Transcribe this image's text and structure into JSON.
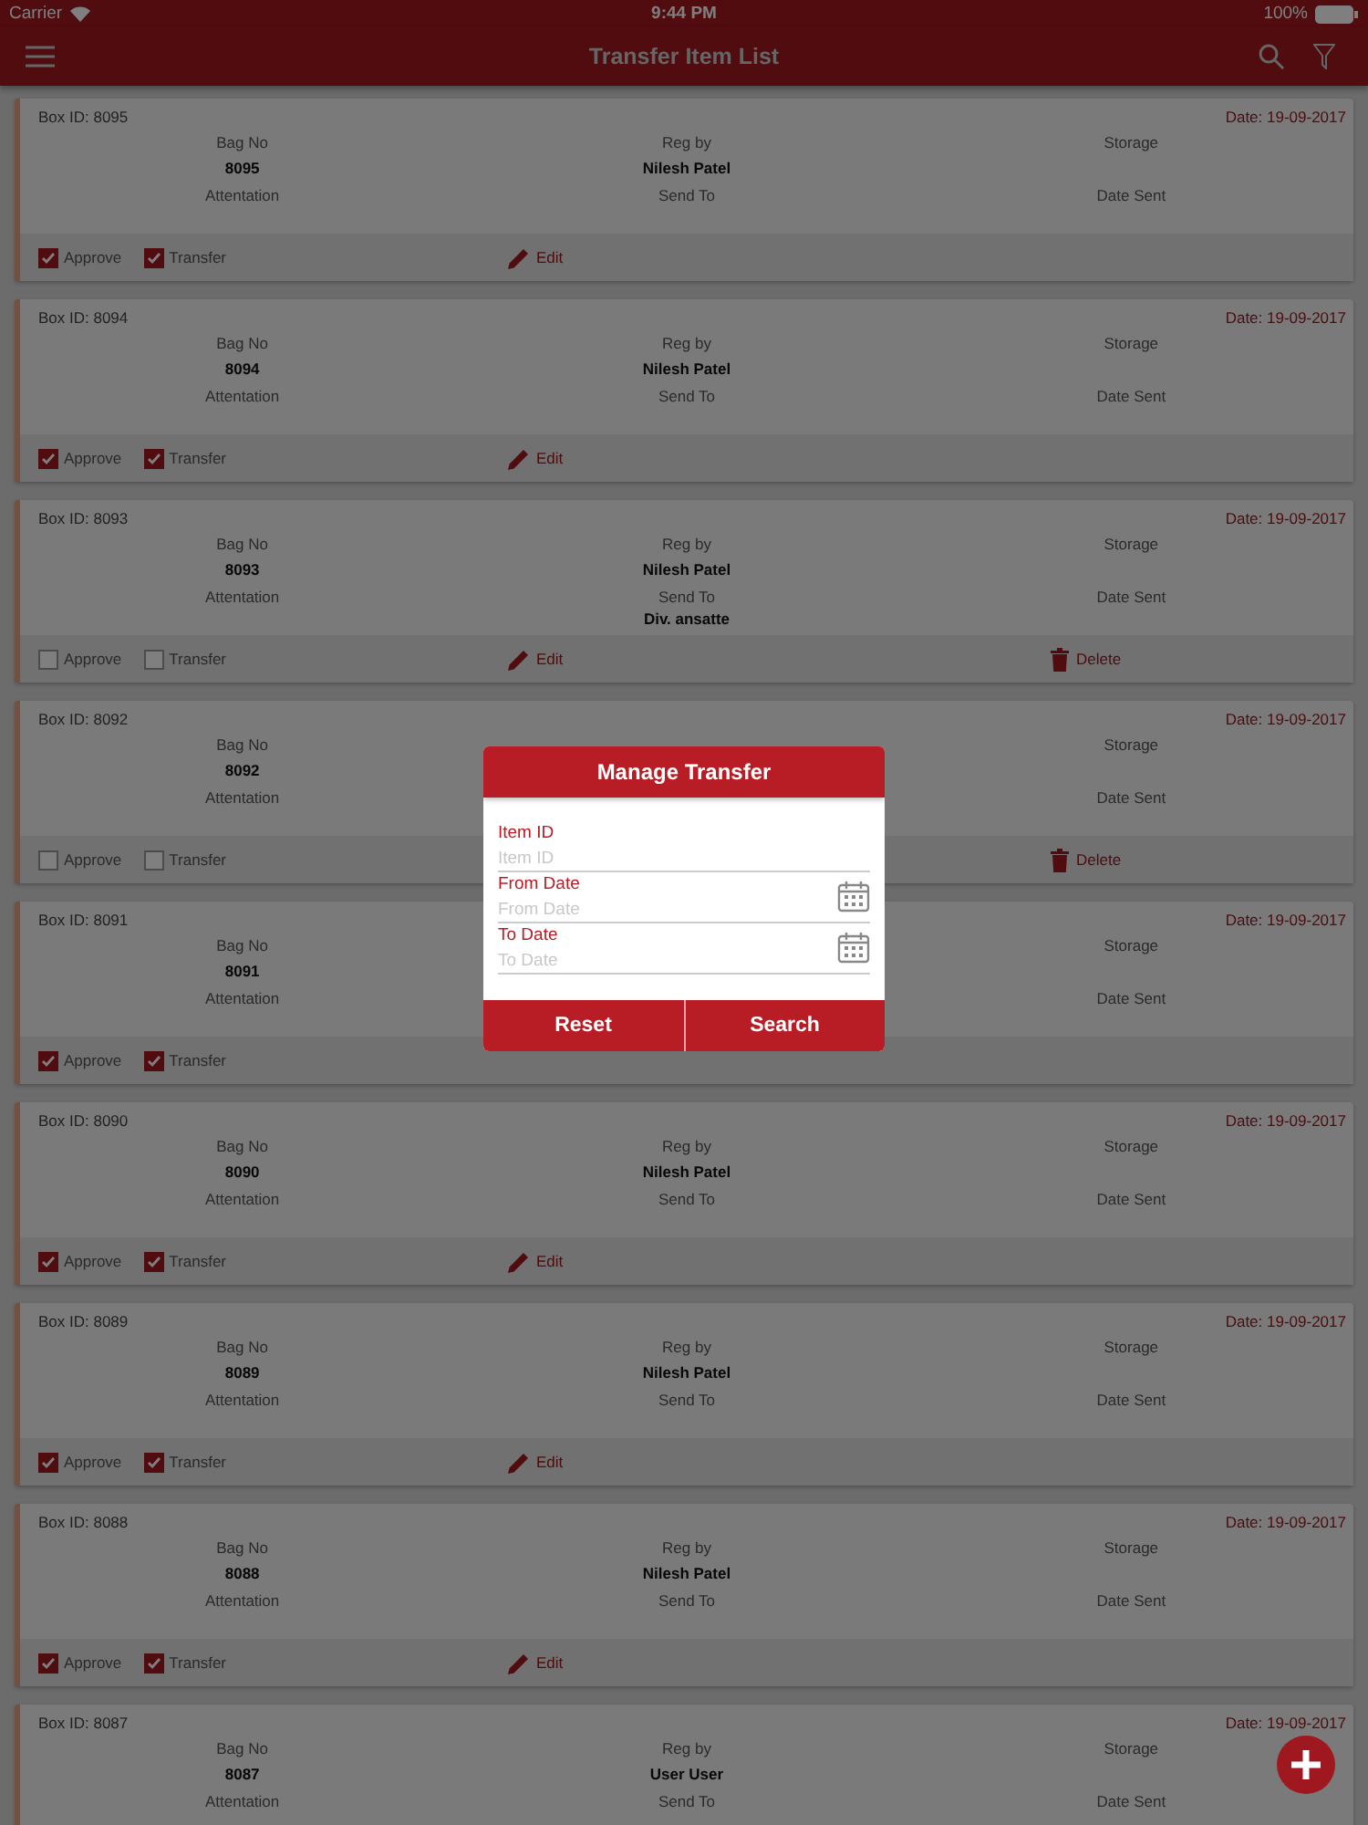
{
  "status_bar": {
    "carrier": "Carrier",
    "time": "9:44 PM",
    "battery": "100%"
  },
  "nav": {
    "title": "Transfer Item List"
  },
  "cards": [
    {
      "box_id": "Box ID: 8095",
      "date": "Date: 19-09-2017",
      "bag_no_label": "Bag No",
      "bag_no": "8095",
      "reg_by_label": "Reg by",
      "reg_by": "Nilesh Patel",
      "storage_label": "Storage",
      "attentation_label": "Attentation",
      "send_to_label": "Send To",
      "date_sent_label": "Date Sent",
      "approve": {
        "label": "Approve",
        "checked": true
      },
      "transfer": {
        "label": "Transfer",
        "checked": true
      },
      "edit": "Edit"
    },
    {
      "box_id": "Box ID: 8094",
      "date": "Date: 19-09-2017",
      "bag_no_label": "Bag No",
      "bag_no": "8094",
      "reg_by_label": "Reg by",
      "reg_by": "Nilesh Patel",
      "storage_label": "Storage",
      "attentation_label": "Attentation",
      "send_to_label": "Send To",
      "date_sent_label": "Date Sent",
      "approve": {
        "label": "Approve",
        "checked": true
      },
      "transfer": {
        "label": "Transfer",
        "checked": true
      },
      "edit": "Edit"
    },
    {
      "box_id": "Box ID: 8093",
      "date": "Date: 19-09-2017",
      "bag_no_label": "Bag No",
      "bag_no": "8093",
      "reg_by_label": "Reg by",
      "reg_by": "Nilesh Patel",
      "storage_label": "Storage",
      "attentation_label": "Attentation",
      "send_to_label": "Send To",
      "send_to": "Div. ansatte",
      "date_sent_label": "Date Sent",
      "approve": {
        "label": "Approve",
        "checked": false
      },
      "transfer": {
        "label": "Transfer",
        "checked": false
      },
      "edit": "Edit",
      "delete": "Delete"
    },
    {
      "box_id": "Box ID: 8092",
      "date": "Date: 19-09-2017",
      "bag_no_label": "Bag No",
      "bag_no": "8092",
      "storage_label": "Storage",
      "attentation_label": "Attentation",
      "date_sent_label": "Date Sent",
      "approve": {
        "label": "Approve",
        "checked": false
      },
      "transfer": {
        "label": "Transfer",
        "checked": false
      },
      "delete": "Delete"
    },
    {
      "box_id": "Box ID: 8091",
      "date": "Date: 19-09-2017",
      "bag_no_label": "Bag No",
      "bag_no": "8091",
      "storage_label": "Storage",
      "attentation_label": "Attentation",
      "date_sent_label": "Date Sent",
      "approve": {
        "label": "Approve",
        "checked": true
      },
      "transfer": {
        "label": "Transfer",
        "checked": true
      }
    },
    {
      "box_id": "Box ID: 8090",
      "date": "Date: 19-09-2017",
      "bag_no_label": "Bag No",
      "bag_no": "8090",
      "reg_by_label": "Reg by",
      "reg_by": "Nilesh Patel",
      "storage_label": "Storage",
      "attentation_label": "Attentation",
      "send_to_label": "Send To",
      "date_sent_label": "Date Sent",
      "approve": {
        "label": "Approve",
        "checked": true
      },
      "transfer": {
        "label": "Transfer",
        "checked": true
      },
      "edit": "Edit"
    },
    {
      "box_id": "Box ID: 8089",
      "date": "Date: 19-09-2017",
      "bag_no_label": "Bag No",
      "bag_no": "8089",
      "reg_by_label": "Reg by",
      "reg_by": "Nilesh Patel",
      "storage_label": "Storage",
      "attentation_label": "Attentation",
      "send_to_label": "Send To",
      "date_sent_label": "Date Sent",
      "approve": {
        "label": "Approve",
        "checked": true
      },
      "transfer": {
        "label": "Transfer",
        "checked": true
      },
      "edit": "Edit"
    },
    {
      "box_id": "Box ID: 8088",
      "date": "Date: 19-09-2017",
      "bag_no_label": "Bag No",
      "bag_no": "8088",
      "reg_by_label": "Reg by",
      "reg_by": "Nilesh Patel",
      "storage_label": "Storage",
      "attentation_label": "Attentation",
      "send_to_label": "Send To",
      "date_sent_label": "Date Sent",
      "approve": {
        "label": "Approve",
        "checked": true
      },
      "transfer": {
        "label": "Transfer",
        "checked": true
      },
      "edit": "Edit"
    },
    {
      "box_id": "Box ID: 8087",
      "date": "Date: 19-09-2017",
      "bag_no_label": "Bag No",
      "bag_no": "8087",
      "reg_by_label": "Reg by",
      "reg_by": "User User",
      "storage_label": "Storage",
      "attentation_label": "Attentation",
      "send_to_label": "Send To",
      "date_sent_label": "Date Sent"
    }
  ],
  "dialog": {
    "title": "Manage Transfer",
    "fields": [
      {
        "label": "Item ID",
        "placeholder": "Item ID",
        "kind": "text"
      },
      {
        "label": "From Date",
        "placeholder": "From Date",
        "kind": "date"
      },
      {
        "label": "To Date",
        "placeholder": "To Date",
        "kind": "date"
      }
    ],
    "buttons": [
      "Reset",
      "Search"
    ]
  }
}
